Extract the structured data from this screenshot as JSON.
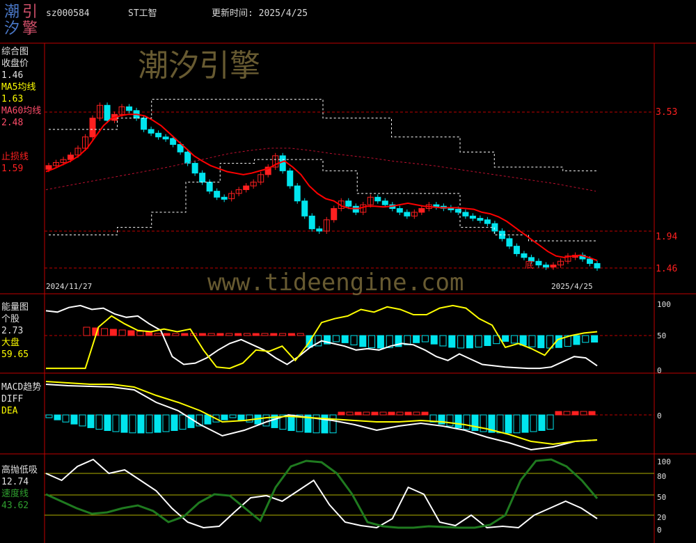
{
  "logo": {
    "c1": "潮",
    "c2": "引",
    "c3": "汐",
    "c4": "擎"
  },
  "header": {
    "code": "sz000584",
    "name": "ST工智",
    "update_label": "更新时间: 2025/4/25"
  },
  "watermark": {
    "cn": "潮汐引擎",
    "url": "www.tideengine.com"
  },
  "panels": {
    "main": {
      "title": "综合图",
      "close_label": "收盘价",
      "close_value": "1.46",
      "ma5_label": "MA5均线",
      "ma5_value": "1.63",
      "ma60_label": "MA60均线",
      "ma60_value": "2.48",
      "stop_label": "止损线",
      "stop_value": "1.59",
      "price_ticks": [
        "3.53",
        "1.94",
        "1.46"
      ],
      "date_start": "2024/11/27",
      "date_end": "2025/4/25",
      "bottom_marker": "底"
    },
    "energy": {
      "title": "能量图",
      "stock_label": "个股",
      "stock_value": "2.73",
      "market_label": "大盘",
      "market_value": "59.65",
      "ticks": [
        "100",
        "50",
        "0"
      ]
    },
    "macd": {
      "title": "MACD趋势",
      "diff_label": "DIFF",
      "dea_label": "DEA",
      "ticks": [
        "0"
      ]
    },
    "gp": {
      "title": "高抛低吸",
      "value": "12.74",
      "speed_label": "速度线",
      "speed_value": "43.62",
      "ticks": [
        "100",
        "80",
        "50",
        "20",
        "0"
      ]
    }
  },
  "colors": {
    "up": "#ff2020",
    "down": "#00e5ee",
    "ma5": "#ff0000",
    "yellow": "#ffff00",
    "green": "#1f7a1f",
    "white": "#ffffff",
    "axis": "#c00000"
  },
  "chart_data": {
    "type": "candlestick",
    "close": [
      2.82,
      2.86,
      2.9,
      2.96,
      3.05,
      3.2,
      3.45,
      3.62,
      3.42,
      3.5,
      3.6,
      3.55,
      3.45,
      3.3,
      3.25,
      3.2,
      3.18,
      3.1,
      3.0,
      2.85,
      2.72,
      2.6,
      2.48,
      2.4,
      2.38,
      2.45,
      2.5,
      2.55,
      2.6,
      2.7,
      2.8,
      2.95,
      2.75,
      2.55,
      2.35,
      2.15,
      1.98,
      1.95,
      2.1,
      2.25,
      2.35,
      2.28,
      2.2,
      2.3,
      2.4,
      2.35,
      2.3,
      2.25,
      2.2,
      2.15,
      2.2,
      2.25,
      2.3,
      2.28,
      2.26,
      2.24,
      2.2,
      2.15,
      2.12,
      2.1,
      2.05,
      1.95,
      1.85,
      1.75,
      1.65,
      1.6,
      1.55,
      1.5,
      1.48,
      1.5,
      1.55,
      1.62,
      1.63,
      1.58,
      1.52,
      1.46
    ],
    "ma5": [
      2.74,
      2.78,
      2.83,
      2.88,
      2.95,
      3.05,
      3.2,
      3.35,
      3.45,
      3.48,
      3.5,
      3.5,
      3.48,
      3.42,
      3.35,
      3.25,
      3.15,
      3.05,
      2.95,
      2.88,
      2.82,
      2.78,
      2.74,
      2.72,
      2.7,
      2.72,
      2.75,
      2.78,
      2.84,
      2.88,
      2.8,
      2.7,
      2.55,
      2.45,
      2.38,
      2.35,
      2.28,
      2.25,
      2.25,
      2.28,
      2.28,
      2.27,
      2.28,
      2.3,
      2.32,
      2.3,
      2.28,
      2.27,
      2.26,
      2.26,
      2.26,
      2.25,
      2.24,
      2.2,
      2.18,
      2.14,
      2.08,
      2.0,
      1.92,
      1.84,
      1.76,
      1.68,
      1.62,
      1.6,
      1.62,
      1.63,
      1.6,
      1.56
    ],
    "ma60": [
      2.5,
      2.55,
      2.6,
      2.65,
      2.7,
      2.75,
      2.8,
      2.86,
      2.92,
      2.98,
      3.02,
      3.05,
      3.05,
      3.02,
      2.98,
      2.95,
      2.92,
      2.88,
      2.85,
      2.82,
      2.78,
      2.74,
      2.7,
      2.66,
      2.62,
      2.58,
      2.53,
      2.48
    ],
    "stop_upper": [
      3.3,
      3.3,
      3.45,
      3.7,
      3.7,
      3.7,
      3.7,
      3.7,
      3.45,
      3.45,
      3.2,
      3.2,
      3.0,
      2.8,
      2.8,
      2.75
    ],
    "stop_lower": [
      1.9,
      1.9,
      2.0,
      2.2,
      2.6,
      2.85,
      2.9,
      2.9,
      2.75,
      2.45,
      2.45,
      2.45,
      2.0,
      1.9,
      1.82,
      1.82
    ],
    "price_ticks": [
      3.53,
      1.94,
      1.46
    ],
    "energy_stock_last": 2.73,
    "energy_market_last": 59.65,
    "gp_last": 12.74,
    "speed_last": 43.62,
    "gp_ticks": [
      100,
      80,
      50,
      20,
      0
    ]
  }
}
